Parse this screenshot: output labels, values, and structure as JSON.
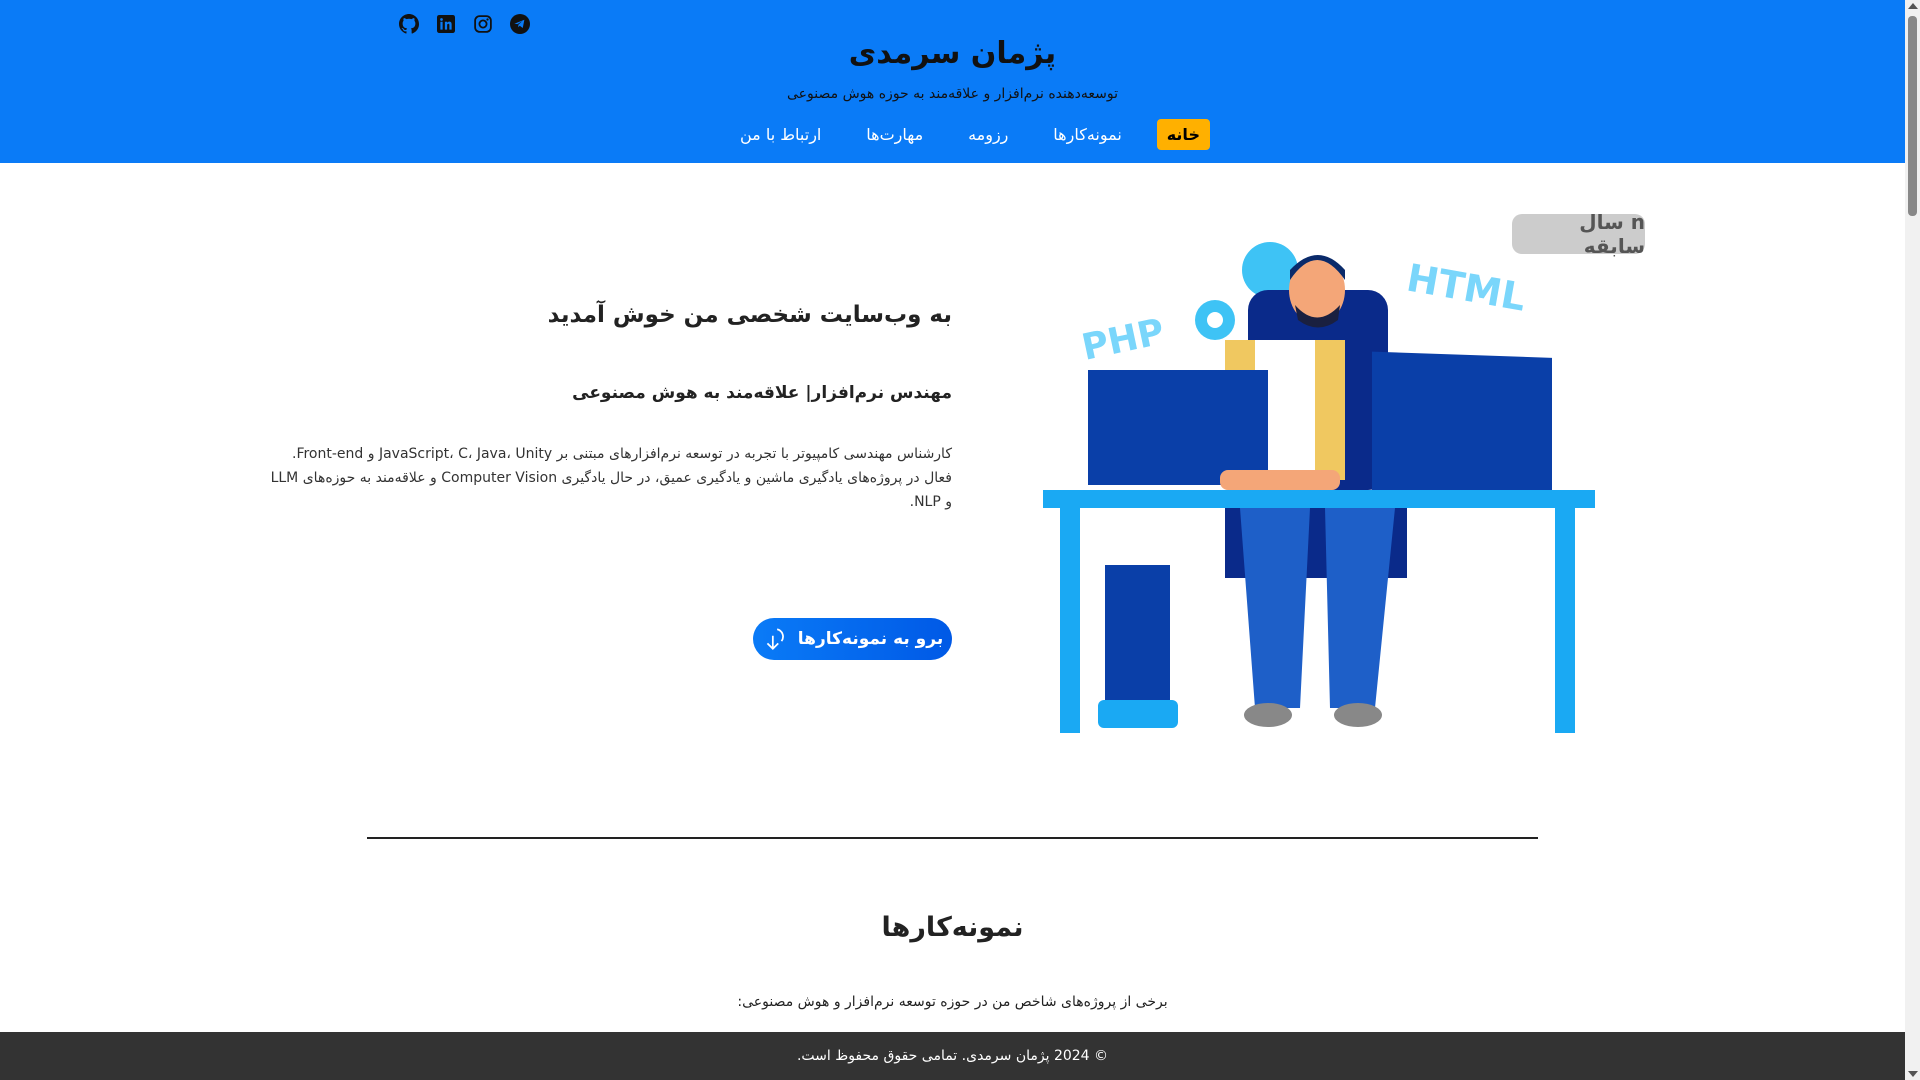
{
  "header": {
    "title": "پژمان سرمدی",
    "subtitle": "توسعه‌دهنده نرم‌افزار و علاقه‌مند به حوزه هوش مصنوعی",
    "social": [
      "github-icon",
      "linkedin-icon",
      "instagram-icon",
      "telegram-icon"
    ],
    "nav": [
      {
        "label": "خانه",
        "active": true
      },
      {
        "label": "نمونه‌کارها"
      },
      {
        "label": "رزومه"
      },
      {
        "label": "مهارت‌ها"
      },
      {
        "label": "ارتباط با من"
      }
    ]
  },
  "hero": {
    "heading": "به وب‌سایت شخصی من خوش آمدید",
    "subheading": "مهندس نرم‌افزار| علاقه‌مند به هوش مصنوعی",
    "paragraph": "کارشناس مهندسی کامپیوتر با تجربه در توسعه نرم‌افزارهای مبتنی بر JavaScript، C، Java، Unity و Front-end. فعال در پروژه‌های یادگیری ماشین و یادگیری عمیق، در حال یادگیری Computer Vision و علاقه‌مند به حوزه‌های LLM و NLP.",
    "cta": "برو به نمونه‌کارها",
    "badge": "n سال سابقه",
    "illus_php": "PHP",
    "illus_html": "HTML"
  },
  "portfolio": {
    "title": "نمونه‌کارها",
    "description": "برخی از پروژه‌های شاخص من در حوزه توسعه نرم‌افزار و هوش مصنوعی:"
  },
  "footer": {
    "text": "© 2024 پژمان سرمدی. تمامی حقوق محفوظ است."
  },
  "colors": {
    "header": "#0a7bf7",
    "active_nav": "#ffb000",
    "footer": "#333333"
  }
}
